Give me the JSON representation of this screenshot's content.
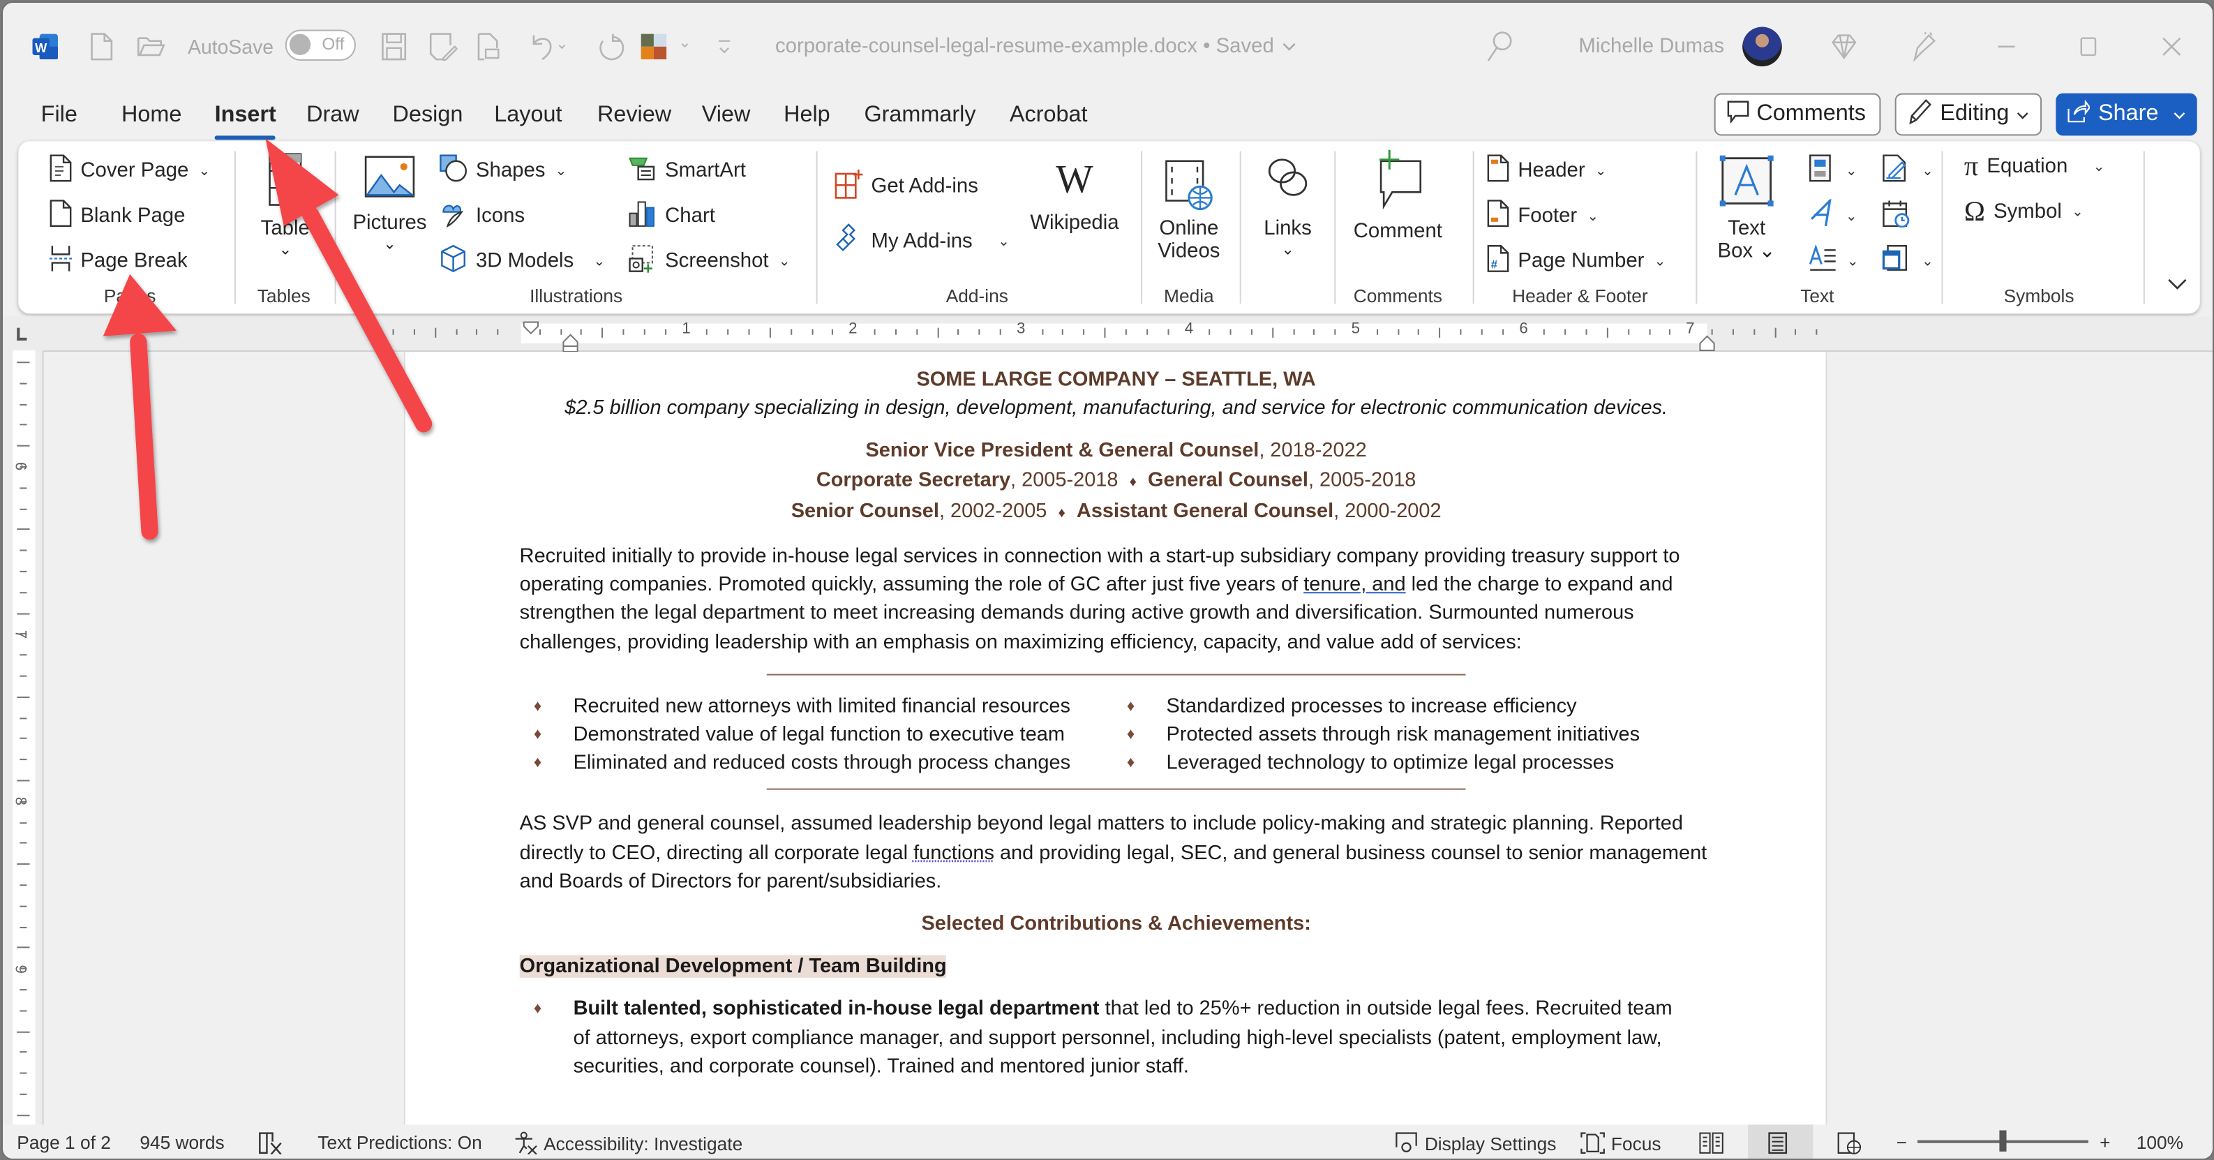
{
  "titlebar": {
    "autosave_label": "AutoSave",
    "autosave_state": "Off",
    "document_title": "corporate-counsel-legal-resume-example.docx • Saved",
    "user_name": "Michelle Dumas"
  },
  "menu": {
    "tabs": [
      "File",
      "Home",
      "Insert",
      "Draw",
      "Design",
      "Layout",
      "Review",
      "View",
      "Help",
      "Grammarly",
      "Acrobat"
    ],
    "active_tab": "Insert",
    "comments_label": "Comments",
    "editing_label": "Editing",
    "share_label": "Share"
  },
  "ribbon": {
    "pages": {
      "label": "Pages",
      "cover_page": "Cover Page",
      "blank_page": "Blank Page",
      "page_break": "Page Break"
    },
    "tables": {
      "label": "Tables",
      "table": "Table"
    },
    "illustrations": {
      "label": "Illustrations",
      "pictures": "Pictures",
      "shapes": "Shapes",
      "icons": "Icons",
      "models_3d": "3D Models",
      "smartart": "SmartArt",
      "chart": "Chart",
      "screenshot": "Screenshot"
    },
    "addins": {
      "label": "Add-ins",
      "get_addins": "Get Add-ins",
      "my_addins": "My Add-ins",
      "wikipedia": "Wikipedia"
    },
    "media": {
      "label": "Media",
      "online_videos_1": "Online",
      "online_videos_2": "Videos"
    },
    "links": {
      "label": "Links"
    },
    "comments": {
      "label": "Comments",
      "comment": "Comment"
    },
    "header_footer": {
      "label": "Header & Footer",
      "header": "Header",
      "footer": "Footer",
      "page_number": "Page Number"
    },
    "text": {
      "label": "Text",
      "text_box_1": "Text",
      "text_box_2": "Box"
    },
    "symbols": {
      "label": "Symbols",
      "equation": "Equation",
      "symbol": "Symbol"
    }
  },
  "ruler": {
    "h_numbers": [
      "1",
      "2",
      "3",
      "4",
      "5",
      "6",
      "7"
    ],
    "v_numbers": [
      "6",
      "7",
      "8",
      "9"
    ]
  },
  "document": {
    "company": "SOME LARGE COMPANY – SEATTLE, WA",
    "company_desc": "$2.5 billion company specializing in design, development, manufacturing, and service for electronic communication devices.",
    "roles": {
      "r1_title": "Senior Vice President & General Counsel",
      "r1_years": ", 2018-2022",
      "r2_title": "Corporate Secretary",
      "r2_years": ", 2005-2018",
      "r3_title": "General Counsel",
      "r3_years": ", 2005-2018",
      "r4_title": "Senior Counsel",
      "r4_years": ", 2002-2005",
      "r5_title": "Assistant General Counsel",
      "r5_years": ", 2000-2002",
      "sep": "♦"
    },
    "para1_a": "Recruited initially to provide in-house legal services in connection with a start-up subsidiary company providing treasury support to operating companies. Promoted quickly, assuming the role of GC after just five years of ",
    "para1_ul": "tenure, and",
    "para1_b": " led the charge to expand and strengthen the legal department to meet increasing demands during active growth and diversification. Surmounted numerous challenges, providing leadership with an emphasis on maximizing efficiency, capacity, and value add of services:",
    "bullets": [
      "Recruited new attorneys with limited financial resources",
      "Standardized processes to increase efficiency",
      "Demonstrated value of legal function to executive team",
      "Protected assets through risk management initiatives",
      "Eliminated and reduced costs through process changes",
      "Leveraged technology to optimize legal processes"
    ],
    "para2_a": "AS SVP and general counsel, assumed leadership beyond legal matters to include policy-making and strategic planning. Reported directly to CEO, directing all corporate legal ",
    "para2_ul": "functions",
    "para2_b": " and providing legal, SEC, and general business counsel to senior management and Boards of Directors for parent/subsidiaries.",
    "section_heading": "Selected Contributions & Achievements:",
    "subheading": "Organizational Development / Team Building",
    "achievement_bold": "Built talented, sophisticated in-house legal department",
    "achievement_rest": " that led to 25%+ reduction in outside legal fees. Recruited team of attorneys, export compliance manager, and support personnel, including high-level specialists (patent, employment law, securities, and corporate counsel). Trained and mentored junior staff.",
    "bullet_glyph": "♦"
  },
  "statusbar": {
    "page": "Page 1 of 2",
    "words": "945 words",
    "text_predictions": "Text Predictions: On",
    "accessibility": "Accessibility: Investigate",
    "display_settings": "Display Settings",
    "focus": "Focus",
    "zoom_level": "100%",
    "zoom_fraction": 0.5
  },
  "colors": {
    "accent": "#1c5fc2",
    "heading_brown": "#5e3b2a",
    "highlight": "#ecdcd6",
    "annotation_arrow": "#f44448"
  }
}
